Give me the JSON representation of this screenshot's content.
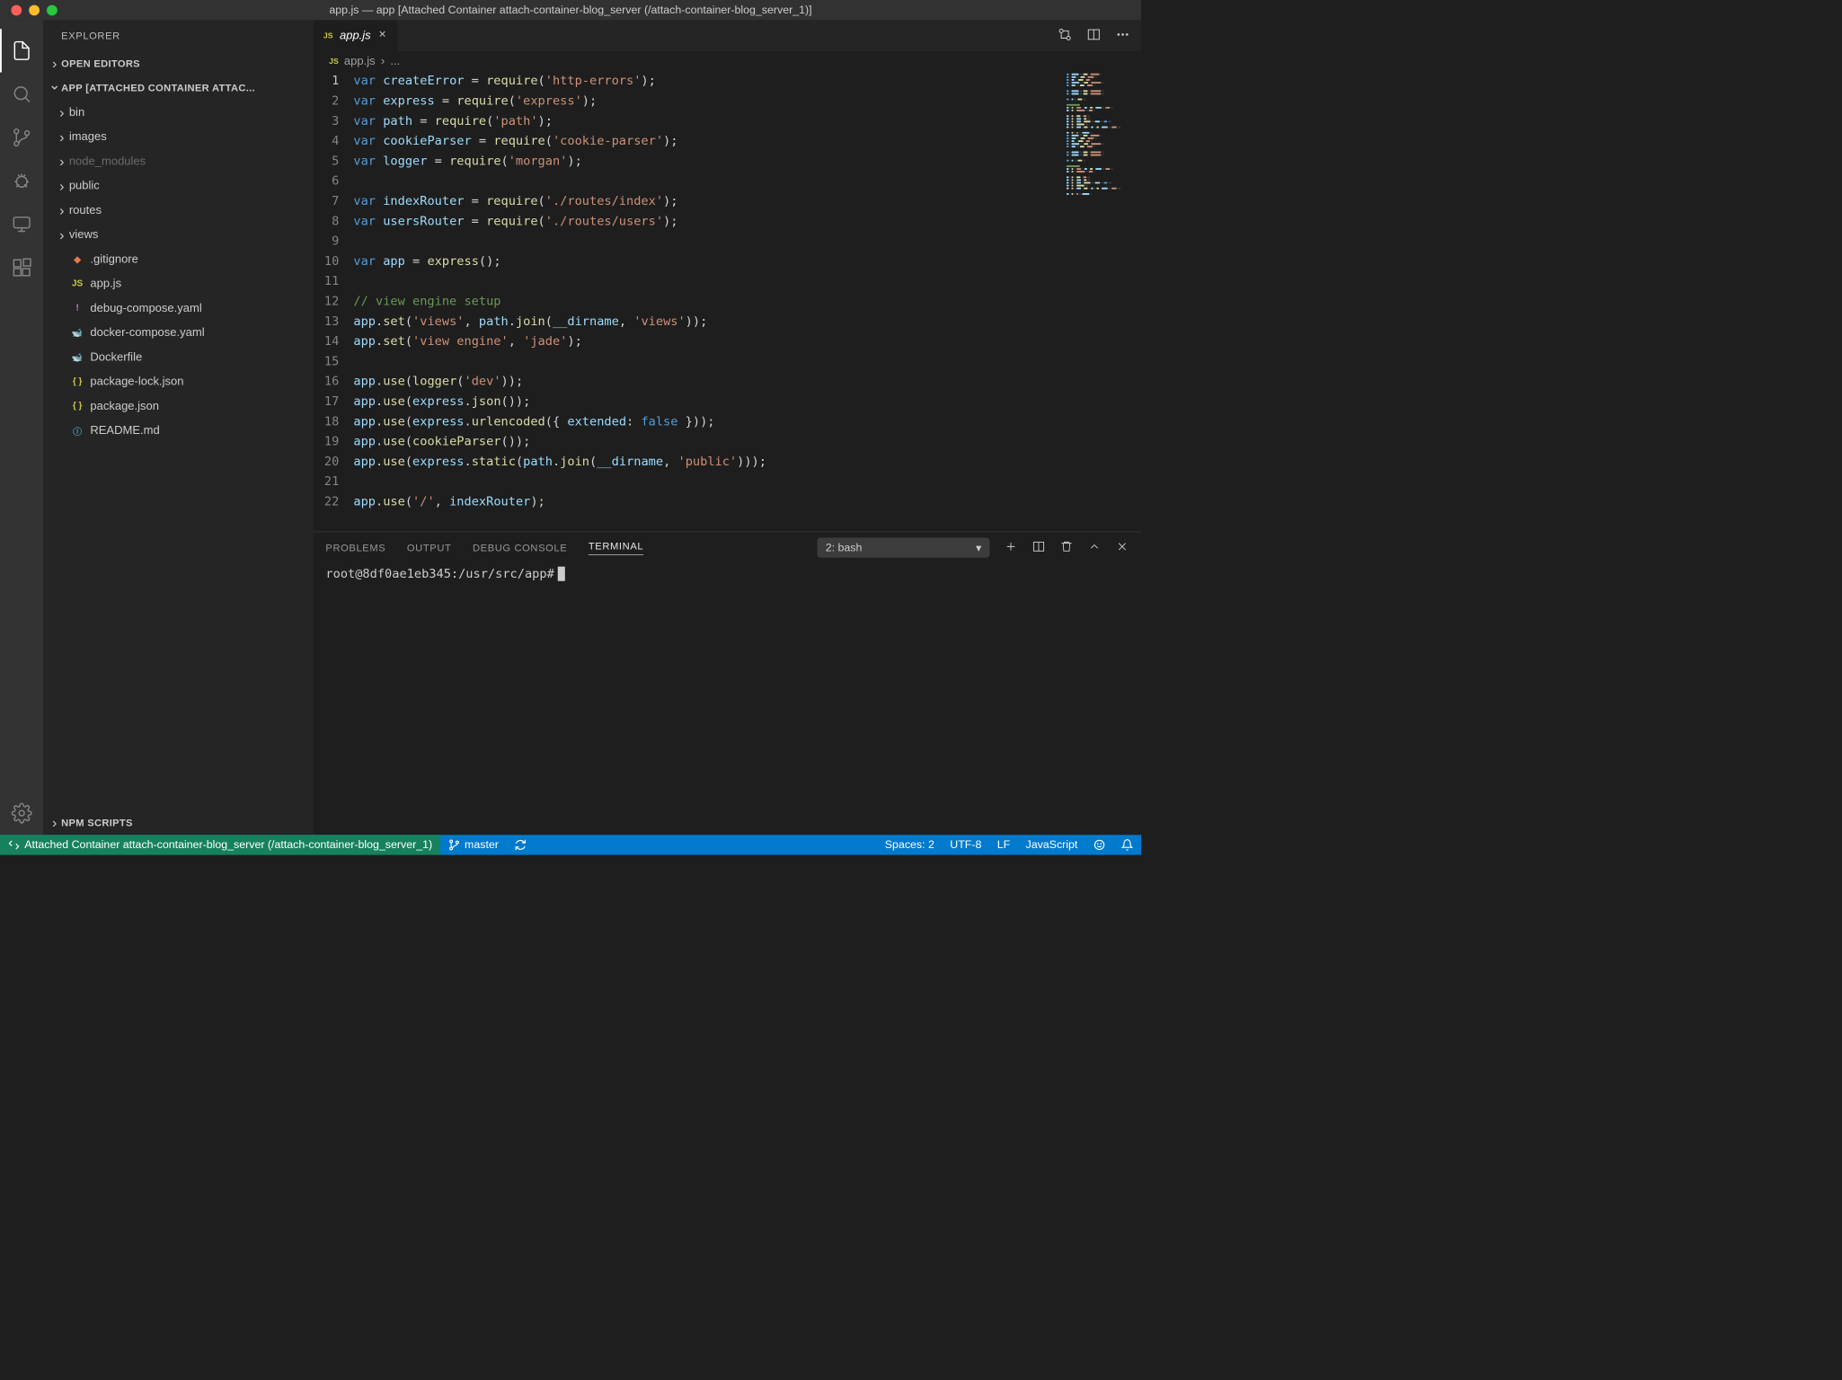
{
  "window": {
    "title": "app.js — app [Attached Container attach-container-blog_server (/attach-container-blog_server_1)]"
  },
  "sidebar": {
    "title": "EXPLORER",
    "sections": {
      "openEditors": "OPEN EDITORS",
      "workspace": "APP [ATTACHED CONTAINER ATTAC...",
      "npmScripts": "NPM SCRIPTS"
    },
    "tree": [
      {
        "name": "bin",
        "type": "folder"
      },
      {
        "name": "images",
        "type": "folder"
      },
      {
        "name": "node_modules",
        "type": "folder",
        "dim": true
      },
      {
        "name": "public",
        "type": "folder"
      },
      {
        "name": "routes",
        "type": "folder"
      },
      {
        "name": "views",
        "type": "folder"
      },
      {
        "name": ".gitignore",
        "type": "file",
        "icon": "git"
      },
      {
        "name": "app.js",
        "type": "file",
        "icon": "js"
      },
      {
        "name": "debug-compose.yaml",
        "type": "file",
        "icon": "yaml"
      },
      {
        "name": "docker-compose.yaml",
        "type": "file",
        "icon": "docker"
      },
      {
        "name": "Dockerfile",
        "type": "file",
        "icon": "docker"
      },
      {
        "name": "package-lock.json",
        "type": "file",
        "icon": "json"
      },
      {
        "name": "package.json",
        "type": "file",
        "icon": "json"
      },
      {
        "name": "README.md",
        "type": "file",
        "icon": "readme"
      }
    ]
  },
  "tabs": {
    "active": {
      "label": "app.js",
      "icon": "JS"
    }
  },
  "breadcrumbs": {
    "file": "app.js",
    "sep": "›",
    "more": "..."
  },
  "editor": {
    "lines": [
      [
        [
          "kw",
          "var"
        ],
        [
          "sp",
          " "
        ],
        [
          "var",
          "createError"
        ],
        [
          "sp",
          " = "
        ],
        [
          "fn",
          "require"
        ],
        [
          "sp",
          "("
        ],
        [
          "str",
          "'http-errors'"
        ],
        [
          "sp",
          ");"
        ]
      ],
      [
        [
          "kw",
          "var"
        ],
        [
          "sp",
          " "
        ],
        [
          "var",
          "express"
        ],
        [
          "sp",
          " = "
        ],
        [
          "fn",
          "require"
        ],
        [
          "sp",
          "("
        ],
        [
          "str",
          "'express'"
        ],
        [
          "sp",
          ");"
        ]
      ],
      [
        [
          "kw",
          "var"
        ],
        [
          "sp",
          " "
        ],
        [
          "var",
          "path"
        ],
        [
          "sp",
          " = "
        ],
        [
          "fn",
          "require"
        ],
        [
          "sp",
          "("
        ],
        [
          "str",
          "'path'"
        ],
        [
          "sp",
          ");"
        ]
      ],
      [
        [
          "kw",
          "var"
        ],
        [
          "sp",
          " "
        ],
        [
          "var",
          "cookieParser"
        ],
        [
          "sp",
          " = "
        ],
        [
          "fn",
          "require"
        ],
        [
          "sp",
          "("
        ],
        [
          "str",
          "'cookie-parser'"
        ],
        [
          "sp",
          ");"
        ]
      ],
      [
        [
          "kw",
          "var"
        ],
        [
          "sp",
          " "
        ],
        [
          "var",
          "logger"
        ],
        [
          "sp",
          " = "
        ],
        [
          "fn",
          "require"
        ],
        [
          "sp",
          "("
        ],
        [
          "str",
          "'morgan'"
        ],
        [
          "sp",
          ");"
        ]
      ],
      [],
      [
        [
          "kw",
          "var"
        ],
        [
          "sp",
          " "
        ],
        [
          "var",
          "indexRouter"
        ],
        [
          "sp",
          " = "
        ],
        [
          "fn",
          "require"
        ],
        [
          "sp",
          "("
        ],
        [
          "str",
          "'./routes/index'"
        ],
        [
          "sp",
          ");"
        ]
      ],
      [
        [
          "kw",
          "var"
        ],
        [
          "sp",
          " "
        ],
        [
          "var",
          "usersRouter"
        ],
        [
          "sp",
          " = "
        ],
        [
          "fn",
          "require"
        ],
        [
          "sp",
          "("
        ],
        [
          "str",
          "'./routes/users'"
        ],
        [
          "sp",
          ");"
        ]
      ],
      [],
      [
        [
          "kw",
          "var"
        ],
        [
          "sp",
          " "
        ],
        [
          "var",
          "app"
        ],
        [
          "sp",
          " = "
        ],
        [
          "fn",
          "express"
        ],
        [
          "sp",
          "();"
        ]
      ],
      [],
      [
        [
          "cmt",
          "// view engine setup"
        ]
      ],
      [
        [
          "var",
          "app"
        ],
        [
          "sp",
          "."
        ],
        [
          "fn",
          "set"
        ],
        [
          "sp",
          "("
        ],
        [
          "str",
          "'views'"
        ],
        [
          "sp",
          ", "
        ],
        [
          "var",
          "path"
        ],
        [
          "sp",
          "."
        ],
        [
          "fn",
          "join"
        ],
        [
          "sp",
          "("
        ],
        [
          "var",
          "__dirname"
        ],
        [
          "sp",
          ", "
        ],
        [
          "str",
          "'views'"
        ],
        [
          "sp",
          "));"
        ]
      ],
      [
        [
          "var",
          "app"
        ],
        [
          "sp",
          "."
        ],
        [
          "fn",
          "set"
        ],
        [
          "sp",
          "("
        ],
        [
          "str",
          "'view engine'"
        ],
        [
          "sp",
          ", "
        ],
        [
          "str",
          "'jade'"
        ],
        [
          "sp",
          ");"
        ]
      ],
      [],
      [
        [
          "var",
          "app"
        ],
        [
          "sp",
          "."
        ],
        [
          "fn",
          "use"
        ],
        [
          "sp",
          "("
        ],
        [
          "fn",
          "logger"
        ],
        [
          "sp",
          "("
        ],
        [
          "str",
          "'dev'"
        ],
        [
          "sp",
          "));"
        ]
      ],
      [
        [
          "var",
          "app"
        ],
        [
          "sp",
          "."
        ],
        [
          "fn",
          "use"
        ],
        [
          "sp",
          "("
        ],
        [
          "var",
          "express"
        ],
        [
          "sp",
          "."
        ],
        [
          "fn",
          "json"
        ],
        [
          "sp",
          "());"
        ]
      ],
      [
        [
          "var",
          "app"
        ],
        [
          "sp",
          "."
        ],
        [
          "fn",
          "use"
        ],
        [
          "sp",
          "("
        ],
        [
          "var",
          "express"
        ],
        [
          "sp",
          "."
        ],
        [
          "fn",
          "urlencoded"
        ],
        [
          "sp",
          "({ "
        ],
        [
          "prop",
          "extended"
        ],
        [
          "sp",
          ": "
        ],
        [
          "const",
          "false"
        ],
        [
          "sp",
          " }));"
        ]
      ],
      [
        [
          "var",
          "app"
        ],
        [
          "sp",
          "."
        ],
        [
          "fn",
          "use"
        ],
        [
          "sp",
          "("
        ],
        [
          "fn",
          "cookieParser"
        ],
        [
          "sp",
          "());"
        ]
      ],
      [
        [
          "var",
          "app"
        ],
        [
          "sp",
          "."
        ],
        [
          "fn",
          "use"
        ],
        [
          "sp",
          "("
        ],
        [
          "var",
          "express"
        ],
        [
          "sp",
          "."
        ],
        [
          "fn",
          "static"
        ],
        [
          "sp",
          "("
        ],
        [
          "var",
          "path"
        ],
        [
          "sp",
          "."
        ],
        [
          "fn",
          "join"
        ],
        [
          "sp",
          "("
        ],
        [
          "var",
          "__dirname"
        ],
        [
          "sp",
          ", "
        ],
        [
          "str",
          "'public'"
        ],
        [
          "sp",
          ")));"
        ]
      ],
      [],
      [
        [
          "var",
          "app"
        ],
        [
          "sp",
          "."
        ],
        [
          "fn",
          "use"
        ],
        [
          "sp",
          "("
        ],
        [
          "str",
          "'/'"
        ],
        [
          "sp",
          ", "
        ],
        [
          "var",
          "indexRouter"
        ],
        [
          "sp",
          ");"
        ]
      ]
    ]
  },
  "panel": {
    "tabs": [
      "PROBLEMS",
      "OUTPUT",
      "DEBUG CONSOLE",
      "TERMINAL"
    ],
    "activeTab": "TERMINAL",
    "terminalSelector": "2: bash",
    "prompt": "root@8df0ae1eb345:/usr/src/app#"
  },
  "statusbar": {
    "remote": "Attached Container attach-container-blog_server (/attach-container-blog_server_1)",
    "branch": "master",
    "spaces": "Spaces: 2",
    "encoding": "UTF-8",
    "eol": "LF",
    "language": "JavaScript"
  }
}
